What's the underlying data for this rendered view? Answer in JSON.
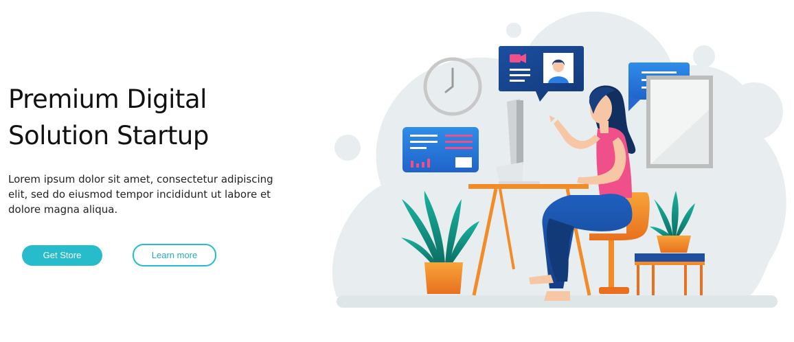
{
  "hero": {
    "title_line1": "Premium Digital",
    "title_line2": "Solution Startup",
    "description": "Lorem ipsum dolor sit amet, consectetur adipiscing elit, sed do eiusmod tempor incididunt ut labore et dolore magna aliqua.",
    "primary_button": "Get Store",
    "secondary_button": "Learn more"
  },
  "colors": {
    "accent": "#27bccc",
    "illustration_blue": "#2a7de1",
    "illustration_orange": "#f28c28",
    "illustration_pink": "#f0508a",
    "cloud_gray": "#e8edef"
  },
  "illustration": {
    "subject": "woman-at-desk-video-call",
    "icons": [
      "clock-icon",
      "video-camera-icon",
      "user-avatar-icon",
      "chat-bubble-icon",
      "dashboard-card-icon",
      "plant-icon",
      "picture-frame-icon"
    ]
  }
}
